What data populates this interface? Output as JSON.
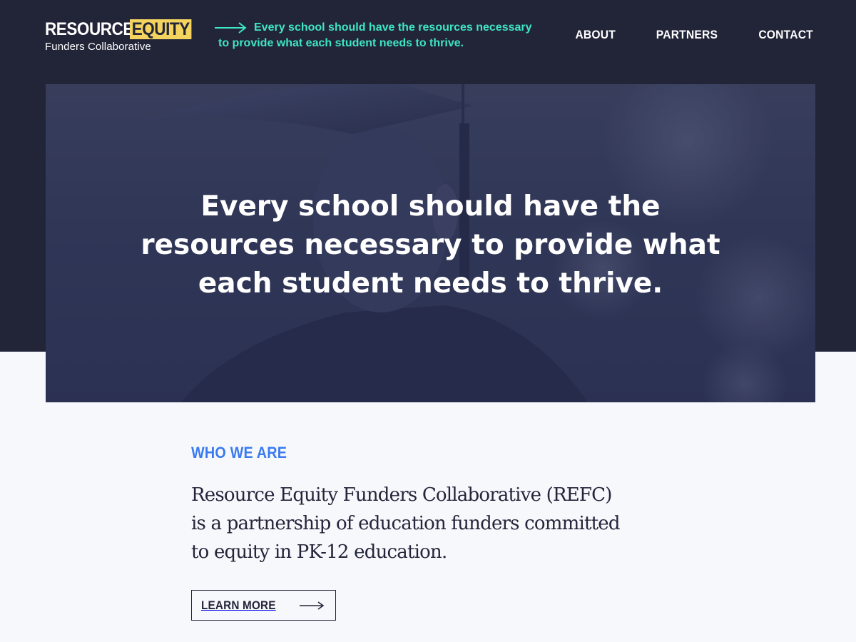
{
  "header": {
    "logo": {
      "word1": "RESOURCE",
      "word2": "EQUITY",
      "subtitle": "Funders Collaborative"
    },
    "tagline": {
      "line1": "Every school should have the resources necessary",
      "line2": "to provide what each student needs to thrive.",
      "icon": "arrow-right-icon"
    },
    "nav": [
      {
        "label": "ABOUT"
      },
      {
        "label": "PARTNERS"
      },
      {
        "label": "CONTACT"
      }
    ]
  },
  "hero": {
    "heading_lines": [
      "Every school should have the",
      "resources necessary to provide what",
      "each student needs to thrive."
    ]
  },
  "who": {
    "label": "WHO WE ARE",
    "text_lines": [
      "Resource Equity Funders Collaborative (REFC)",
      "is a partnership  of education funders committed",
      "to equity in PK-12 education."
    ],
    "button_label": "LEARN MORE",
    "button_icon": "arrow-right-icon"
  },
  "colors": {
    "dark_navy": "#222538",
    "accent_yellow": "#f4d35e",
    "accent_teal": "#3ee6c4",
    "accent_blue": "#3a7bf0",
    "page_bg": "#f7f8fc"
  }
}
